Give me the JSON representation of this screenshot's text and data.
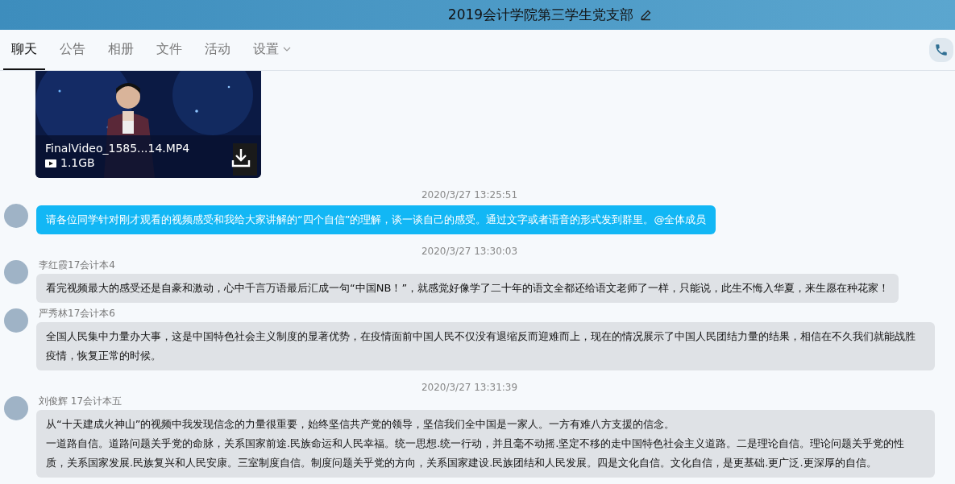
{
  "window": {
    "title": "2019会计学院第三学生党支部"
  },
  "tabs": [
    {
      "label": "聊天",
      "selected": true,
      "dropdown": false
    },
    {
      "label": "公告",
      "selected": false,
      "dropdown": false
    },
    {
      "label": "相册",
      "selected": false,
      "dropdown": false
    },
    {
      "label": "文件",
      "selected": false,
      "dropdown": false
    },
    {
      "label": "活动",
      "selected": false,
      "dropdown": false
    },
    {
      "label": "设置",
      "selected": false,
      "dropdown": true
    }
  ],
  "chat": [
    {
      "kind": "video",
      "filename": "FinalVideo_1585...14.MP4",
      "size": "1.1GB"
    },
    {
      "kind": "time",
      "text": "2020/3/27 13:25:51"
    },
    {
      "kind": "broadcast",
      "text": "请各位同学针对刚才观看的视频感受和我给大家讲解的“四个自信”的理解，谈一谈自己的感受。通过文字或者语音的形式发到群里。@全体成员"
    },
    {
      "kind": "time",
      "text": "2020/3/27 13:30:03"
    },
    {
      "kind": "message",
      "sender": "李红霞17会计本4",
      "text": "看完视频最大的感受还是自豪和激动，心中千言万语最后汇成一句“中国NB！”，就感觉好像学了二十年的语文全都还给语文老师了一样，只能说，此生不悔入华夏，来生愿在种花家！"
    },
    {
      "kind": "message",
      "sender": "严秀林17会计本6",
      "text": "全国人民集中力量办大事，这是中国特色社会主义制度的显著优势，在疫情面前中国人民不仅没有退缩反而迎难而上，现在的情况展示了中国人民团结力量的结果，相信在不久我们就能战胜疫情，恢复正常的时候。"
    },
    {
      "kind": "time",
      "text": "2020/3/27 13:31:39"
    },
    {
      "kind": "message",
      "sender": "刘俊辉 17会计本五",
      "text": "从“十天建成火神山”的视频中我发现信念的力量很重要，始终坚信共产党的领导，坚信我们全中国是一家人。一方有难八方支援的信念。",
      "text_2": "一道路自信。道路问题关乎党的命脉，关系国家前途.民族命运和人民幸福。统一思想.统一行动，并且毫不动摇.坚定不移的走中国特色社会主义道路。二是理论自信。理论问题关乎党的性质，关系国家发展.民族复兴和人民安康。三室制度自信。制度问题关乎党的方向，关系国家建设.民族团结和人民发展。四是文化自信。文化自信，是更基础.更广泛.更深厚的自信。"
    }
  ]
}
